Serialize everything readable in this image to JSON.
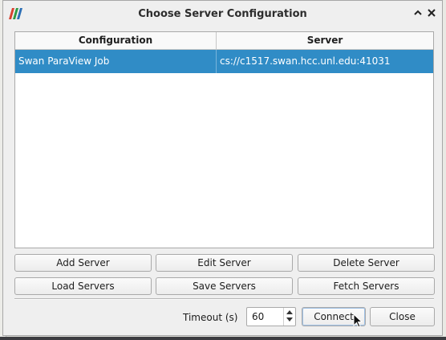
{
  "window": {
    "title": "Choose Server Configuration",
    "app_icon": "paraview-logo-icon",
    "controls": {
      "up": "▲",
      "close": "✕"
    }
  },
  "table": {
    "headers": [
      "Configuration",
      "Server"
    ],
    "rows": [
      {
        "configuration": "Swan ParaView Job",
        "server": "cs://c1517.swan.hcc.unl.edu:41031",
        "selected": true
      }
    ]
  },
  "buttons": {
    "add_server": "Add Server",
    "edit_server": "Edit Server",
    "delete_server": "Delete Server",
    "load_servers": "Load Servers",
    "save_servers": "Save Servers",
    "fetch_servers": "Fetch Servers",
    "connect": "Connect",
    "close": "Close"
  },
  "timeout": {
    "label": "Timeout (s)",
    "value": "60"
  },
  "colors": {
    "selection": "#308cc6",
    "dialog_bg": "#efefef"
  }
}
